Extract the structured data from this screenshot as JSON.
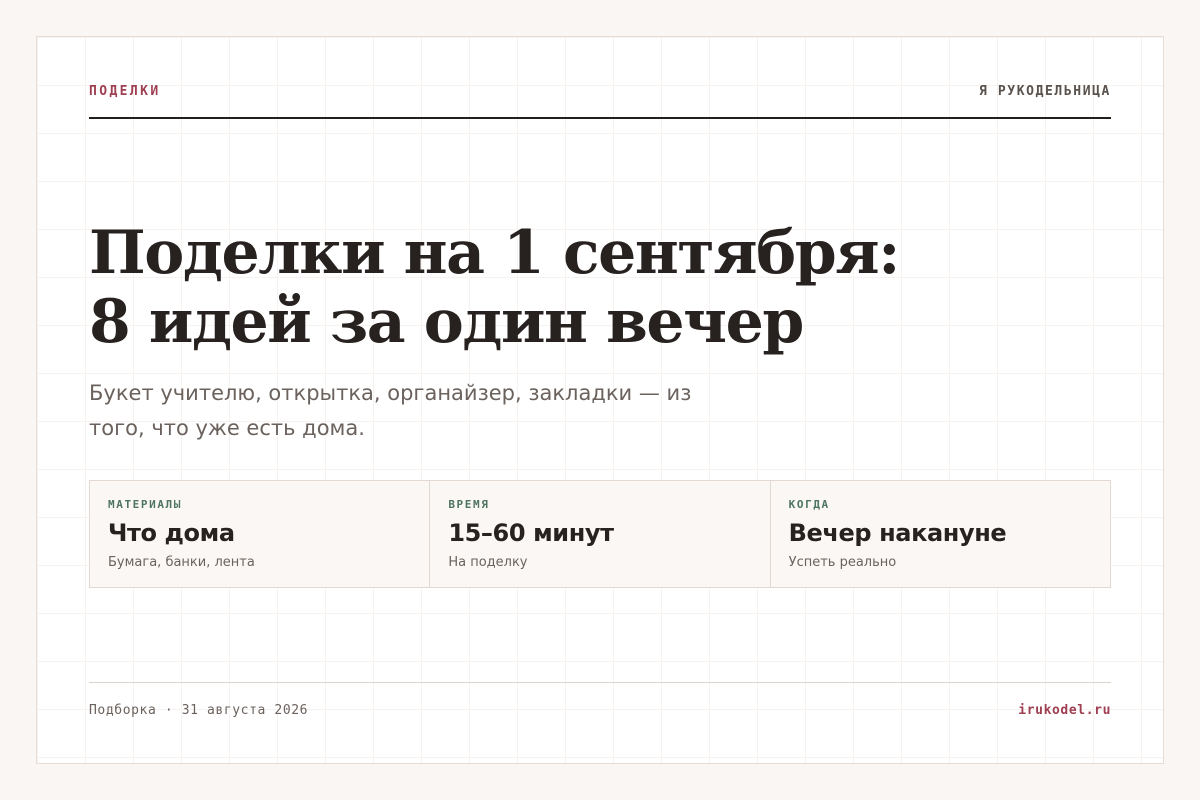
{
  "header": {
    "section": "ПОДЕЛКИ",
    "brand": "Я РУКОДЕЛЬНИЦА"
  },
  "article": {
    "title_line_1": "Поделки на 1 сентября:",
    "title_line_2": "8 идей за один вечер",
    "lead": "Букет учителю, открытка, органайзер, закладки — из того, что уже есть дома."
  },
  "facts": [
    {
      "label": "МАТЕРИАЛЫ",
      "value": "Что дома",
      "note": "Бумага, банки, лента"
    },
    {
      "label": "ВРЕМЯ",
      "value": "15–60 минут",
      "note": "На поделку"
    },
    {
      "label": "КОГДА",
      "value": "Вечер накануне",
      "note": "Успеть реально"
    }
  ],
  "footer": {
    "meta": "Подборка · 31 августа 2026",
    "site": "irukodel.ru"
  },
  "colors": {
    "accent": "#9e3f52",
    "label_green": "#4f7562",
    "text_dark": "#272220",
    "text_muted": "#6b625d",
    "page_background": "#faf6f3"
  }
}
